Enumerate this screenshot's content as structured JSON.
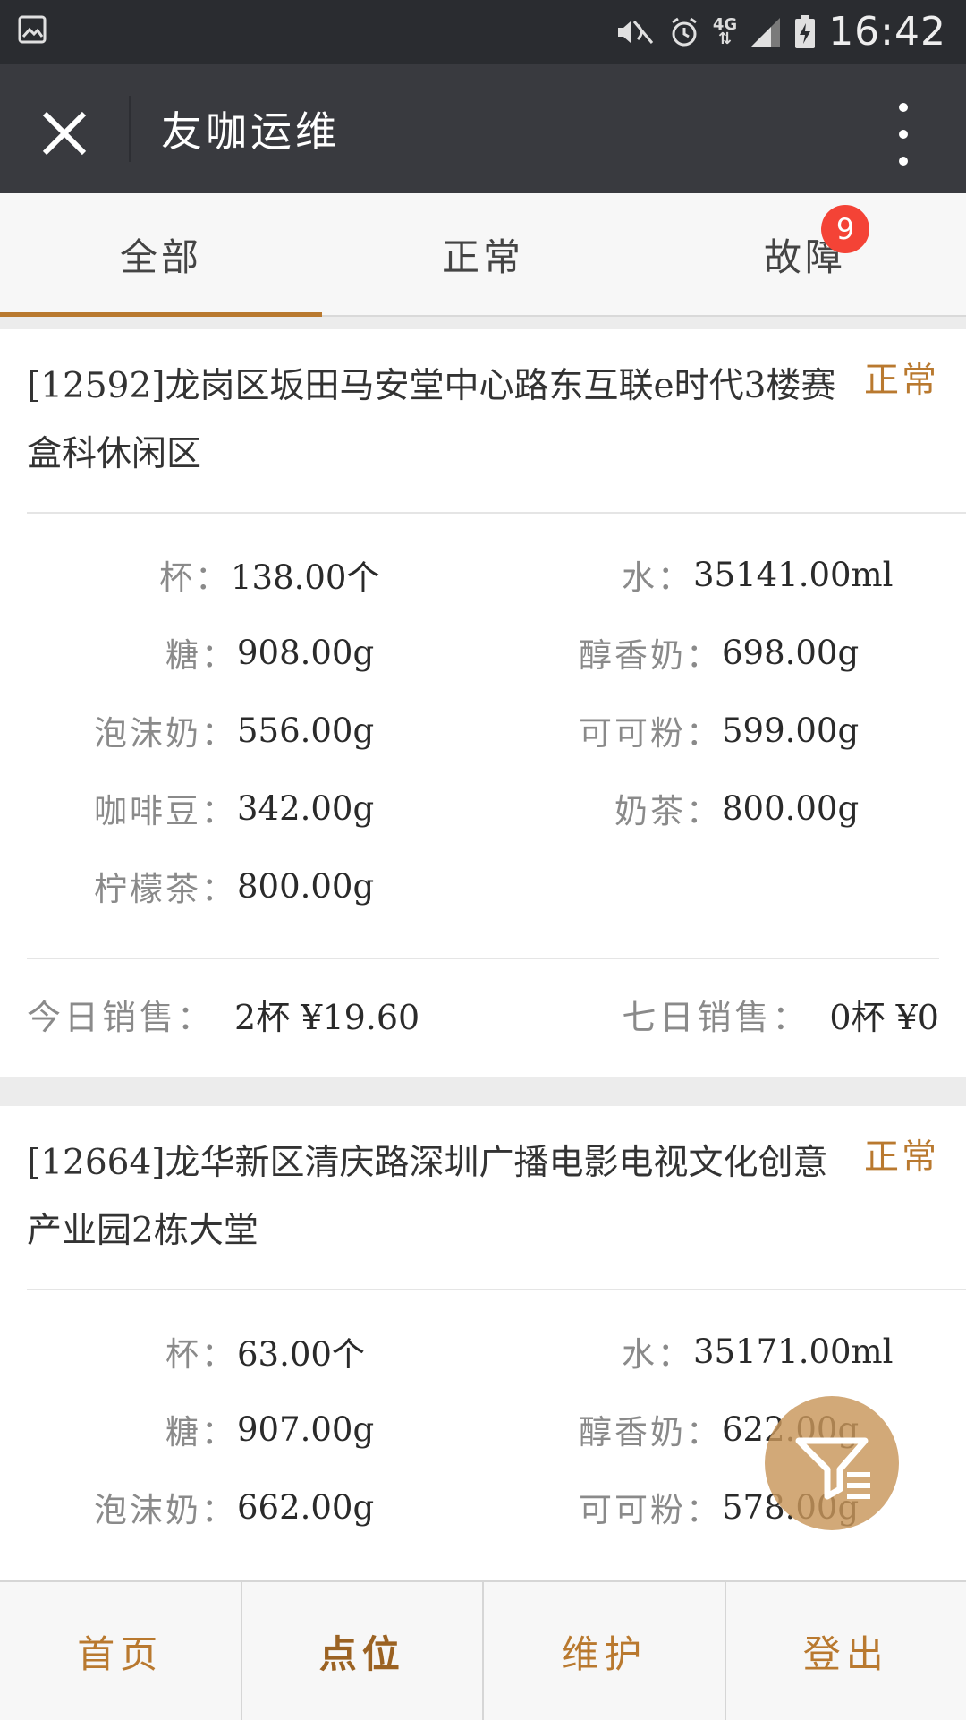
{
  "status_bar": {
    "time": "16:42",
    "network": "4G"
  },
  "app_bar": {
    "title": "友咖运维"
  },
  "tabs": [
    {
      "label": "全部"
    },
    {
      "label": "正常"
    },
    {
      "label": "故障",
      "badge": "9"
    }
  ],
  "machines": [
    {
      "name": "[12592]龙岗区坂田马安堂中心路东互联e时代3楼赛盒科休闲区",
      "status": "正常",
      "supplies": [
        {
          "label": "杯：",
          "value": "138.00个"
        },
        {
          "label": "水：",
          "value": "35141.00ml"
        },
        {
          "label": "糖：",
          "value": "908.00g"
        },
        {
          "label": "醇香奶：",
          "value": "698.00g"
        },
        {
          "label": "泡沫奶：",
          "value": "556.00g"
        },
        {
          "label": "可可粉：",
          "value": "599.00g"
        },
        {
          "label": "咖啡豆：",
          "value": "342.00g"
        },
        {
          "label": "奶茶：",
          "value": "800.00g"
        },
        {
          "label": "柠檬茶：",
          "value": "800.00g"
        }
      ],
      "today_sales_label": "今日销售：",
      "today_sales": "2杯 ¥19.60",
      "week_sales_label": "七日销售：",
      "week_sales": "0杯 ¥0"
    },
    {
      "name": "[12664]龙华新区清庆路深圳广播电影电视文化创意产业园2栋大堂",
      "status": "正常",
      "supplies": [
        {
          "label": "杯：",
          "value": "63.00个"
        },
        {
          "label": "水：",
          "value": "35171.00ml"
        },
        {
          "label": "糖：",
          "value": "907.00g"
        },
        {
          "label": "醇香奶：",
          "value": "622.00g"
        },
        {
          "label": "泡沫奶：",
          "value": "662.00g"
        },
        {
          "label": "可可粉：",
          "value": "578.00g"
        }
      ]
    }
  ],
  "bottom_nav": [
    {
      "label": "首页"
    },
    {
      "label": "点位"
    },
    {
      "label": "维护"
    },
    {
      "label": "登出"
    }
  ],
  "colors": {
    "accent": "#b9792f",
    "badge": "#f44336",
    "appbar": "#393a3f"
  },
  "icons": [
    "image-icon",
    "mute-icon",
    "alarm-icon",
    "signal-icon",
    "battery-icon",
    "close-icon",
    "more-icon",
    "filter-icon"
  ]
}
